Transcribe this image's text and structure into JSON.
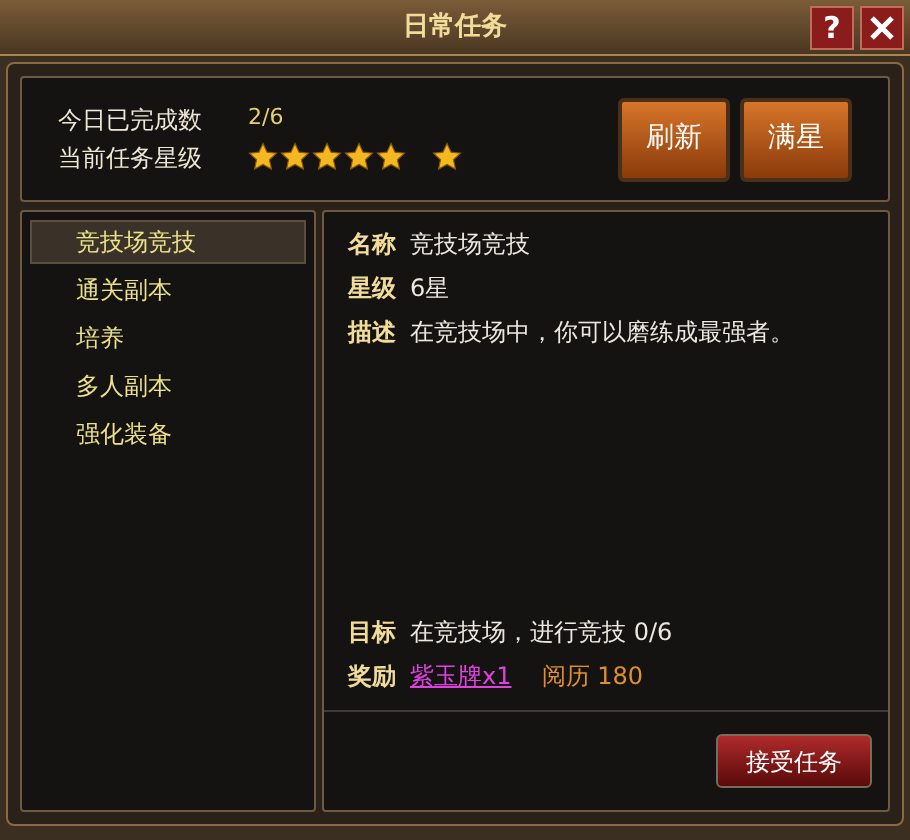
{
  "window": {
    "title": "日常任务",
    "buttons": [
      {
        "kind": "help",
        "label": "?"
      },
      {
        "kind": "close"
      }
    ]
  },
  "summary": {
    "completed_label": "今日已完成数",
    "completed": "2/6",
    "stars_label": "当前任务星级",
    "stars": 6,
    "buttons": [
      "刷新",
      "满星"
    ]
  },
  "tasks": [
    {
      "label": "竞技场竞技",
      "selected": true
    },
    {
      "label": "通关副本",
      "selected": false
    },
    {
      "label": "培养",
      "selected": false
    },
    {
      "label": "多人副本",
      "selected": false
    },
    {
      "label": "强化装备",
      "selected": false
    }
  ],
  "detail": {
    "name_label": "名称",
    "name": "竞技场竞技",
    "level_label": "星级",
    "level": "6星",
    "desc_label": "描述",
    "desc": "在竞技场中，你可以磨练成最强者。",
    "goal_label": "目标",
    "goal": "在竞技场，进行竞技 0/6",
    "reward_label": "奖励",
    "rewards": [
      {
        "kind": "link",
        "text": "紫玉牌x1"
      },
      {
        "kind": "plain",
        "text": "阅历 180"
      }
    ],
    "accept_button": "接受任务"
  }
}
